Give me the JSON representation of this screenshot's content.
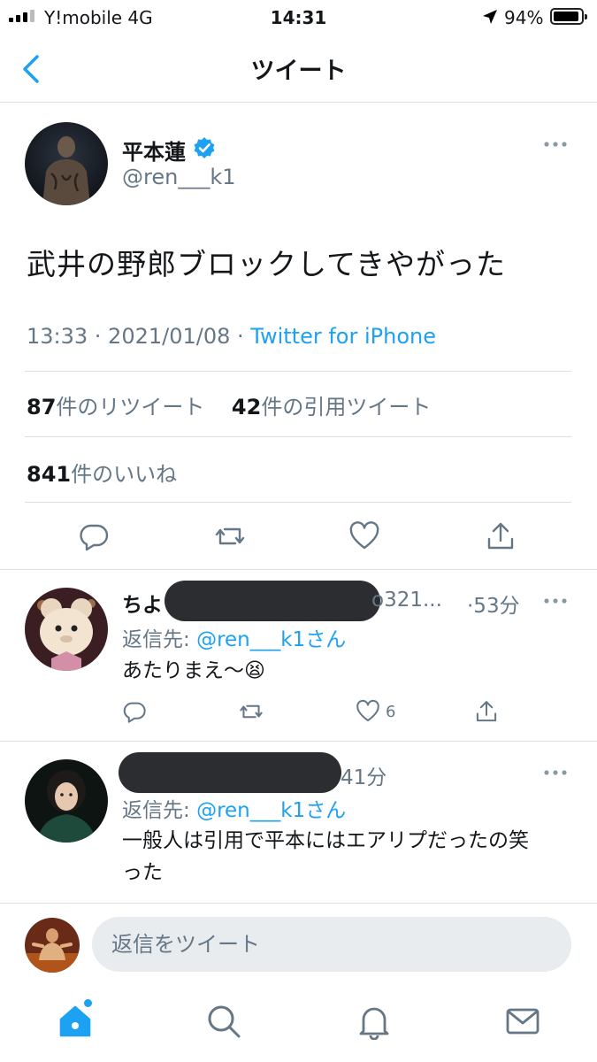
{
  "status_bar": {
    "carrier": "Y!mobile   4G",
    "time": "14:31",
    "battery_percent": "94%",
    "signal_bars_active": 3
  },
  "nav": {
    "title": "ツイート",
    "back_icon": "chevron-left-icon"
  },
  "tweet": {
    "author_name": "平本蓮",
    "author_handle": "@ren___k1",
    "text": "武井の野郎ブロックしてきやがった",
    "time": "13:33 · 2021/01/08 · ",
    "source": "Twitter for iPhone",
    "retweets_count": "87",
    "retweets_label": "件のリツイート",
    "quotes_count": "42",
    "quotes_label": "件の引用ツイート",
    "likes_count": "841",
    "likes_label": "件のいいね"
  },
  "replies": [
    {
      "name": "ちよ",
      "handle_visible": "o321...",
      "time": "·53分",
      "reply_to_prefix": "返信先: ",
      "reply_to_handle": "@ren___k1さん",
      "text": "あたりまえ〜😫",
      "like_count": "6"
    },
    {
      "name": "",
      "handle_visible": "",
      "time": "41分",
      "reply_to_prefix": "返信先: ",
      "reply_to_handle": "@ren___k1さん",
      "text_line1": "一般人は引用で平本にはエアリプだったの笑",
      "text_line2": "った",
      "like_count": ""
    }
  ],
  "compose": {
    "placeholder": "返信をツイート"
  },
  "tab_bar": {
    "items": [
      "home-icon",
      "search-icon",
      "bell-icon",
      "mail-icon"
    ]
  },
  "colors": {
    "accent": "#1da1f2",
    "secondary_text": "#657786",
    "divider": "#d9dfe3"
  }
}
